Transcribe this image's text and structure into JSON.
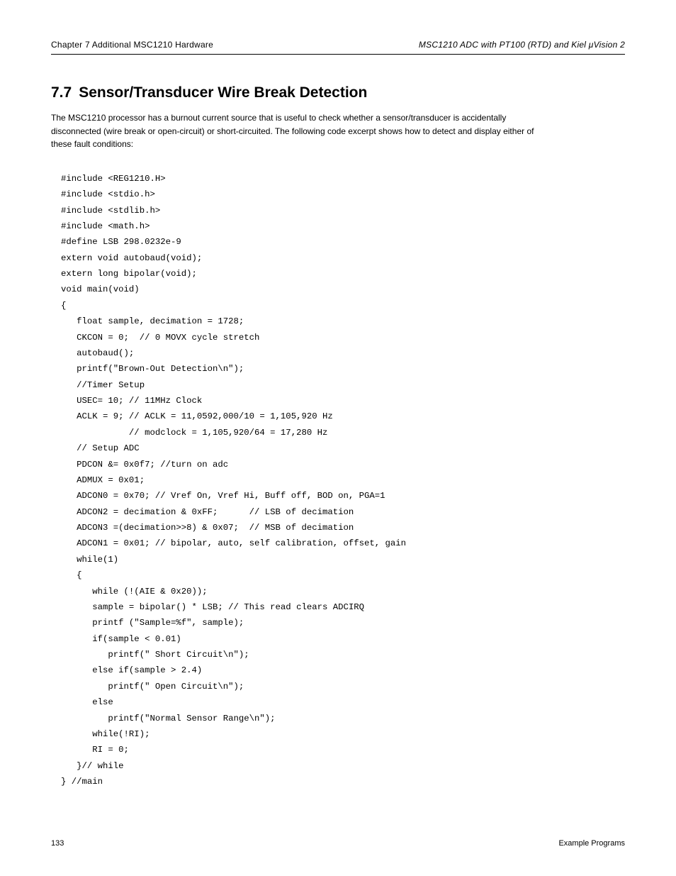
{
  "header": {
    "left": "Chapter 7 Additional MSC1210 Hardware",
    "right_prefix": "MSC1210 ADC with PT100 (RTD) and Kiel ",
    "right_suffix": "Vision 2"
  },
  "section": {
    "number": "7.7",
    "title": "Sensor/Transducer Wire Break Detection"
  },
  "paragraph": "The MSC1210 processor has a burnout current source that is useful to check whether a sensor/transducer is accidentally disconnected (wire break or open-circuit) or short-circuited. The following code excerpt shows how to detect and display either of these fault conditions:",
  "code_lines": [
    "#include <REG1210.H>",
    "#include <stdio.h>",
    "#include <stdlib.h>",
    "#include <math.h>",
    "#define LSB 298.0232e-9",
    "extern void autobaud(void);",
    "extern long bipolar(void);",
    "void main(void)",
    "{",
    "   float sample, decimation = 1728;",
    "   CKCON = 0;  // 0 MOVX cycle stretch",
    "   autobaud();",
    "   printf(\"Brown-Out Detection\\n\");",
    "   //Timer Setup",
    "   USEC= 10; // 11MHz Clock",
    "   ACLK = 9; // ACLK = 11,0592,000/10 = 1,105,920 Hz",
    "             // modclock = 1,105,920/64 = 17,280 Hz",
    "   // Setup ADC",
    "   PDCON &= 0x0f7; //turn on adc",
    "   ADMUX = 0x01;",
    "   ADCON0 = 0x70; // Vref On, Vref Hi, Buff off, BOD on, PGA=1",
    "   ADCON2 = decimation & 0xFF;      // LSB of decimation",
    "   ADCON3 =(decimation>>8) & 0x07;  // MSB of decimation",
    "   ADCON1 = 0x01; // bipolar, auto, self calibration, offset, gain",
    "   while(1)",
    "   {",
    "      while (!(AIE & 0x20));",
    "      sample = bipolar() * LSB; // This read clears ADCIRQ",
    "      printf (\"Sample=%f\", sample);",
    "      if(sample < 0.01)",
    "         printf(\" Short Circuit\\n\");",
    "      else if(sample > 2.4)",
    "         printf(\" Open Circuit\\n\");",
    "      else",
    "         printf(\"Normal Sensor Range\\n\");",
    "      while(!RI);",
    "      RI = 0;",
    "   }// while",
    "} //main"
  ],
  "footer": {
    "left": "133",
    "right": "Example Programs"
  },
  "glyphs": {
    "mu": "μ"
  }
}
